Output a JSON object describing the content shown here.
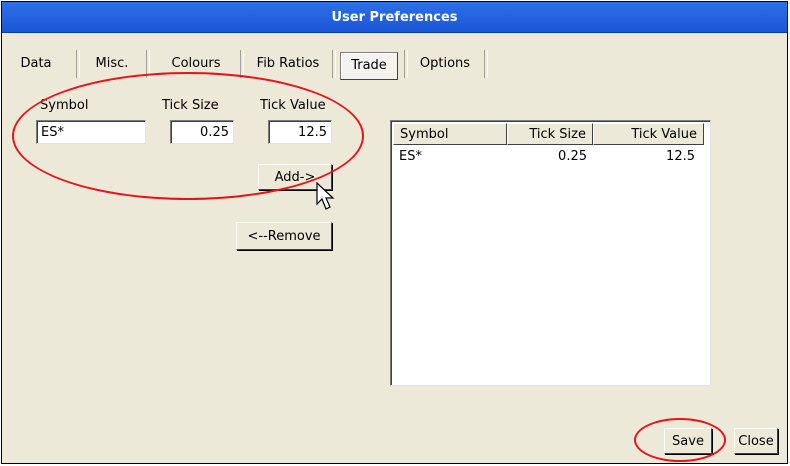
{
  "window": {
    "title": "User Preferences"
  },
  "tabs": [
    {
      "label": "Data"
    },
    {
      "label": "Misc."
    },
    {
      "label": "Colours"
    },
    {
      "label": "Fib Ratios"
    },
    {
      "label": "Trade"
    },
    {
      "label": "Options"
    }
  ],
  "form": {
    "symbol_label": "Symbol",
    "ticksize_label": "Tick Size",
    "tickvalue_label": "Tick Value",
    "symbol_value": "ES*",
    "ticksize_value": "0.25",
    "tickvalue_value": "12.5",
    "add_label": "Add->",
    "remove_label": "<--Remove"
  },
  "list": {
    "columns": [
      "Symbol",
      "Tick Size",
      "Tick Value"
    ],
    "rows": [
      {
        "symbol": "ES*",
        "tick_size": "0.25",
        "tick_value": "12.5"
      }
    ]
  },
  "footer": {
    "save_label": "Save",
    "close_label": "Close"
  },
  "annotations": {
    "highlight_color": "#e8141c"
  }
}
